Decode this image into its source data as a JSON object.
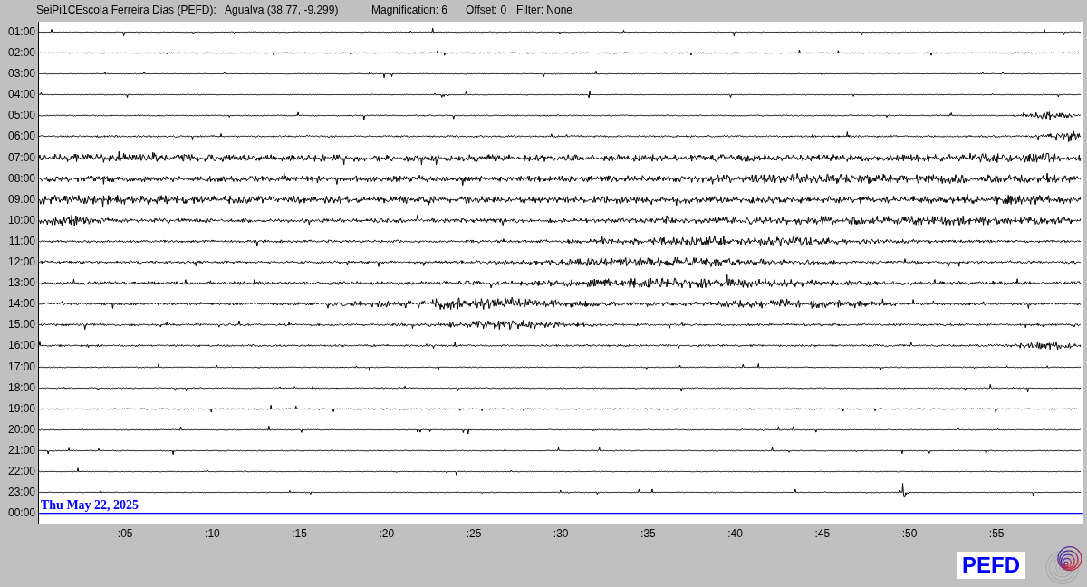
{
  "header": {
    "station": "SeiPi1CEscola Ferreira Dias (PEFD):",
    "location": "Agualva (38.77, -9.299)",
    "magnification": "Magnification: 6",
    "offset": "Offset: 0",
    "filter": "Filter: None"
  },
  "rows": [
    {
      "label": "01:00",
      "current": false
    },
    {
      "label": "02:00",
      "current": false
    },
    {
      "label": "03:00",
      "current": false
    },
    {
      "label": "04:00",
      "current": false
    },
    {
      "label": "05:00",
      "current": false
    },
    {
      "label": "06:00",
      "current": false
    },
    {
      "label": "07:00",
      "current": false
    },
    {
      "label": "08:00",
      "current": false
    },
    {
      "label": "09:00",
      "current": false
    },
    {
      "label": "10:00",
      "current": false
    },
    {
      "label": "11:00",
      "current": false
    },
    {
      "label": "12:00",
      "current": false
    },
    {
      "label": "13:00",
      "current": false
    },
    {
      "label": "14:00",
      "current": false
    },
    {
      "label": "15:00",
      "current": false
    },
    {
      "label": "16:00",
      "current": false
    },
    {
      "label": "17:00",
      "current": false
    },
    {
      "label": "18:00",
      "current": false
    },
    {
      "label": "19:00",
      "current": false
    },
    {
      "label": "20:00",
      "current": false
    },
    {
      "label": "21:00",
      "current": false
    },
    {
      "label": "22:00",
      "current": false
    },
    {
      "label": "23:00",
      "current": false
    },
    {
      "label": "00:00",
      "current": true
    }
  ],
  "date": "Thu May 22, 2025",
  "x_ticks": [
    ":05",
    ":10",
    ":15",
    ":20",
    ":25",
    ":30",
    ":35",
    ":40",
    ":45",
    ":50",
    ":55"
  ],
  "station_badge": "PEFD"
}
